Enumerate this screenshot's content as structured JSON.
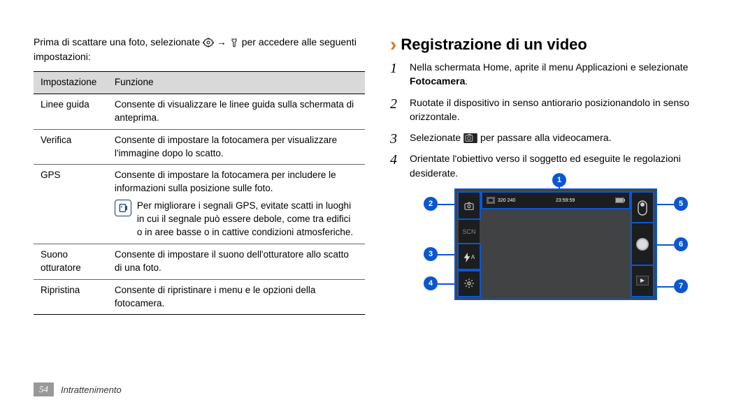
{
  "intro": {
    "before": "Prima di scattare una foto, selezionate ",
    "arrow": "→",
    "after": " per accedere alle seguenti impostazioni:"
  },
  "table": {
    "header": {
      "setting": "Impostazione",
      "function": "Funzione"
    },
    "rows": {
      "guidelines": {
        "name": "Linee guida",
        "desc": "Consente di visualizzare le linee guida sulla schermata di anteprima."
      },
      "review": {
        "name": "Verifica",
        "desc": "Consente di impostare la fotocamera per visualizzare l'immagine dopo lo scatto."
      },
      "gps": {
        "name": "GPS",
        "desc": "Consente di impostare la fotocamera per includere le informazioni sulla posizione sulle foto.",
        "note": "Per migliorare i segnali GPS, evitate scatti in luoghi in cui il segnale può essere debole, come tra edifici o in aree basse o in cattive condizioni atmosferiche."
      },
      "shutter": {
        "name": "Suono otturatore",
        "desc": "Consente di impostare il suono dell'otturatore allo scatto di una foto."
      },
      "reset": {
        "name": "Ripristina",
        "desc": "Consente di ripristinare i menu e le opzioni della fotocamera."
      }
    }
  },
  "heading": {
    "title": "Registrazione di un video"
  },
  "steps": {
    "s1a": "Nella schermata Home, aprite il menu Applicazioni e selezionate ",
    "s1b": "Fotocamera",
    "s1c": ".",
    "s2": "Ruotate il dispositivo in senso antiorario posizionandolo in senso orizzontale.",
    "s3a": "Selezionate ",
    "s3b": " per passare alla videocamera.",
    "s4": "Orientate l'obiettivo verso il soggetto ed eseguite le regolazioni desiderate."
  },
  "viewfinder": {
    "resolution": "320 240",
    "time": "23:59:59",
    "callouts": {
      "c1": "1",
      "c2": "2",
      "c3": "3",
      "c4": "4",
      "c5": "5",
      "c6": "6",
      "c7": "7"
    },
    "left_icons": {
      "mode": "SCN",
      "flash": "A"
    }
  },
  "footer": {
    "page": "54",
    "section": "Intrattenimento"
  }
}
